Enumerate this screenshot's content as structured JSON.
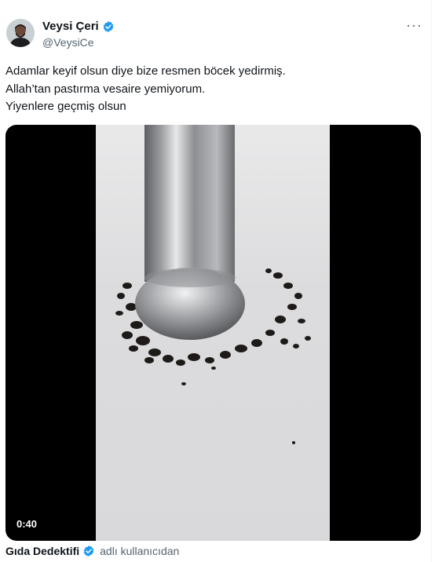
{
  "author": {
    "display_name": "Veysi Çeri",
    "handle": "@VeysiCe",
    "verified": true,
    "avatar_icon": "person-avatar"
  },
  "menu": {
    "more_icon": "ellipsis-icon",
    "more_label": "···"
  },
  "tweet": {
    "lines": [
      "Adamlar keyif olsun diye bize resmen böcek yedirmiş.",
      "Allah’tan pastırma vesaire yemiyorum.",
      "Yiyenlere geçmiş olsun"
    ]
  },
  "media": {
    "type": "video",
    "duration": "0:40"
  },
  "attribution": {
    "source_name": "Gıda Dedektifi",
    "verified": true,
    "suffix": "adlı kullanıcıdan"
  },
  "colors": {
    "text": "#0f1419",
    "secondary": "#536471",
    "verified_blue": "#1d9bf0"
  }
}
